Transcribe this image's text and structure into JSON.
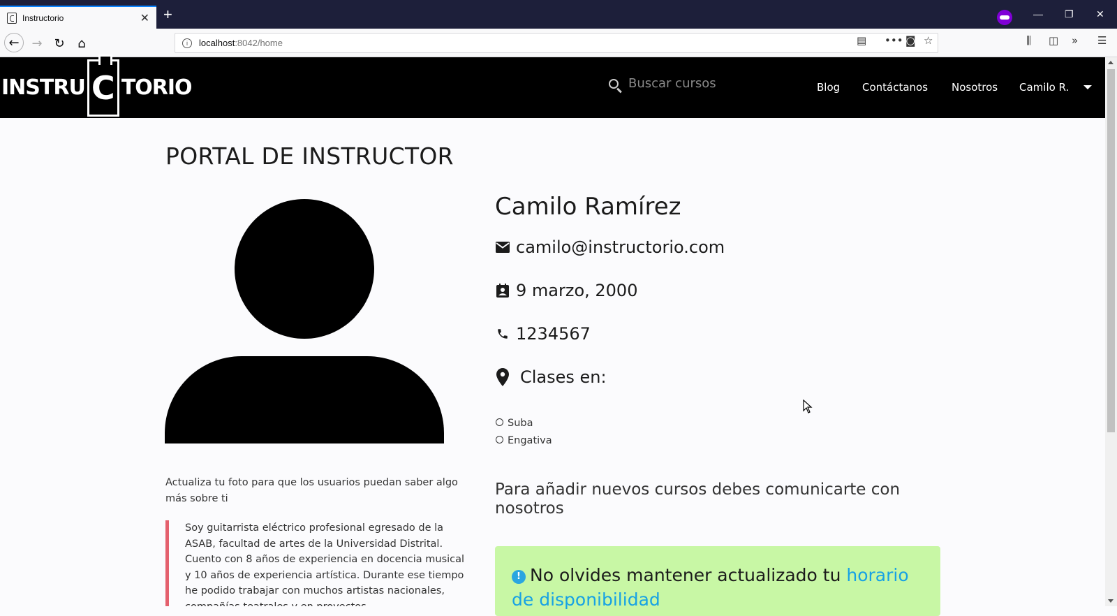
{
  "browser": {
    "tab_title": "Instructorio",
    "url_host": "localhost",
    "url_rest": ":8042/home"
  },
  "header": {
    "logo_left": "INSTRU",
    "logo_mid": "C",
    "logo_right": "TORIO",
    "search_placeholder": "Buscar cursos",
    "nav": {
      "blog": "Blog",
      "contact": "Contáctanos",
      "about": "Nosotros",
      "user": "Camilo R."
    }
  },
  "main": {
    "page_title": "PORTAL DE INSTRUCTOR",
    "avatar_note": "Actualiza tu foto para que los usuarios puedan saber algo más sobre ti",
    "bio": "Soy guitarrista eléctrico profesional egresado de la ASAB, facultad de artes de la Universidad Distrital. Cuento con 8 años de experiencia en docencia musical y 10 años de experiencia artística. Durante ese tiempo he podido trabajar con muchos artistas nacionales, compañías teatrales y en proyectos",
    "profile": {
      "name": "Camilo Ramírez",
      "email": "camilo@instructorio.com",
      "birthdate": "9 marzo, 2000",
      "phone": "1234567",
      "classes_label": "Clases en:",
      "locations": [
        "Suba",
        "Engativa"
      ]
    },
    "courses_note": "Para añadir nuevos cursos debes comunicarte con nosotros",
    "alert": {
      "badge": "!",
      "text": "No olvides mantener actualizado tu ",
      "link": "horario de disponibilidad"
    }
  },
  "colors": {
    "header_bg": "#000000",
    "alert_bg": "#c8f7a5",
    "link": "#17a2e4",
    "quote_border": "#e4606d"
  }
}
